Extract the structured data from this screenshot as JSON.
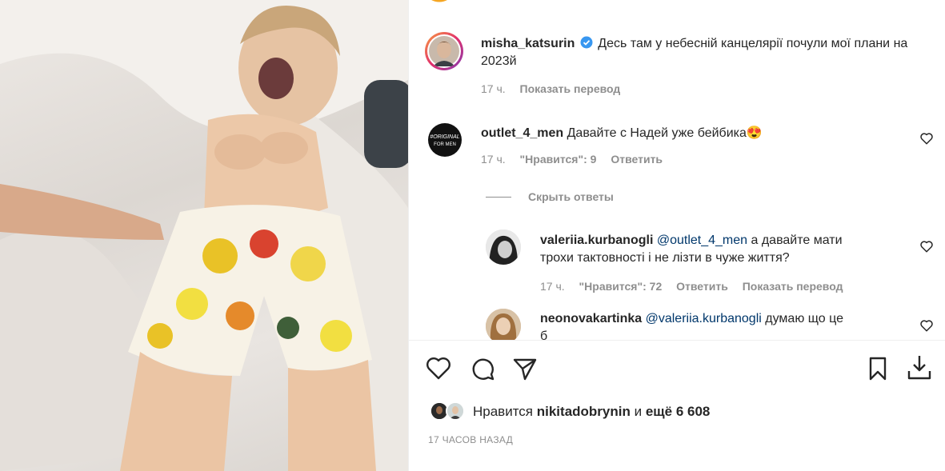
{
  "post": {
    "author": "misha_katsurin",
    "caption": "Десь там у небесній канцелярії почули мої плани на 2023й",
    "caption_age": "17 ч.",
    "caption_translate": "Показать перевод"
  },
  "comments": [
    {
      "username": "outlet_4_men",
      "text": "Давайте с Надей уже бейбика",
      "emoji": "😍",
      "age": "17 ч.",
      "likes": "\"Нравится\": 9",
      "reply": "Ответить",
      "hide_replies": "Скрыть ответы"
    }
  ],
  "replies": [
    {
      "username": "valeriia.kurbanogli",
      "mention": "@outlet_4_men",
      "text_line1": "а давайте мати",
      "text_line2": "трохи тактовності і не лізти в чуже життя?",
      "age": "17 ч.",
      "likes": "\"Нравится\": 72",
      "reply": "Ответить",
      "translate": "Показать перевод"
    },
    {
      "username": "neonovakartinka",
      "mention": "@valeriia.kurbanogli",
      "text": "думаю що це",
      "text_line2": "б"
    }
  ],
  "likes": {
    "prefix": "Нравится",
    "user": "nikitadobrynin",
    "and": "и",
    "count": "ещё 6 608"
  },
  "timestamp": "17 ЧАСОВ НАЗАД",
  "icons": {
    "like": "heart-icon",
    "comment": "comment-bubble-icon",
    "share": "paper-plane-icon",
    "save": "bookmark-icon",
    "download": "download-icon",
    "verified": "verified-badge-icon"
  },
  "colors": {
    "verified": "#3897f0",
    "mention": "#00376b",
    "secondary_text": "#8e8e8e"
  }
}
